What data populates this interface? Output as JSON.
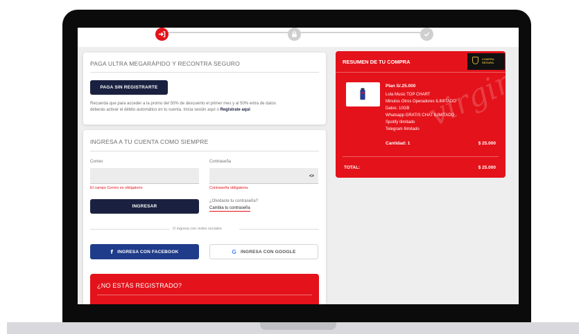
{
  "stepper": {
    "steps": [
      {
        "icon": "login-arrow-icon",
        "state": "active"
      },
      {
        "icon": "lock-icon",
        "state": "inactive"
      },
      {
        "icon": "check-icon",
        "state": "inactive"
      }
    ]
  },
  "guest_card": {
    "title": "PAGA ULTRA MEGARÁPIDO Y RECONTRA SEGURO",
    "button": "PAGA SIN REGISTRARTE",
    "note_line1": "Recuerda que para acceder a la promo del 50% de descuento el primer mes y al 50% extra de datos",
    "note_line2_prefix": "deberás activar el débito automático en tu cuenta. Inicia sesión aquí o",
    "note_link": "Regístrate aquí"
  },
  "login_card": {
    "title": "INGRESA A TU CUENTA COMO SIEMPRE",
    "email_label": "Correo",
    "email_error": "El campo Correo es obligatorio",
    "password_label": "Contraseña",
    "password_error": "Contraseña obligatoria",
    "submit": "INGRESAR",
    "forgot_question": "¿Olvidaste tu contraseña?",
    "forgot_link": "Cambia tu contraseña",
    "divider": "O ingresa con redes sociales",
    "facebook_button": "INGRESA CON FACEBOOK",
    "google_button": "INGRESA CON GOOGLE"
  },
  "register_card": {
    "title": "¿NO ESTÁS REGISTRADO?"
  },
  "summary": {
    "title": "RESUMEN DE TU COMPRA",
    "badge_line1": "COMPRA",
    "badge_line2": "SEGURA",
    "plan": "Plan S/.25.000",
    "features": [
      "Lola Music TOP CHART",
      "Minutos Otros Operadores ILIMITADO",
      "Datos: 10GB",
      "Whatsapp GRATIS CHAT ILIMITADO",
      "Spotify Ilimitado",
      "Telegram Ilimitado"
    ],
    "quantity_label": "Cantidad: 1",
    "price": "$ 25.000",
    "total_label": "TOTAL:",
    "total_value": "$ 25.000",
    "watermark": "virgin mobile"
  },
  "colors": {
    "brand_red": "#e4121a",
    "navy": "#1a2140",
    "facebook_blue": "#1f3c8a"
  }
}
